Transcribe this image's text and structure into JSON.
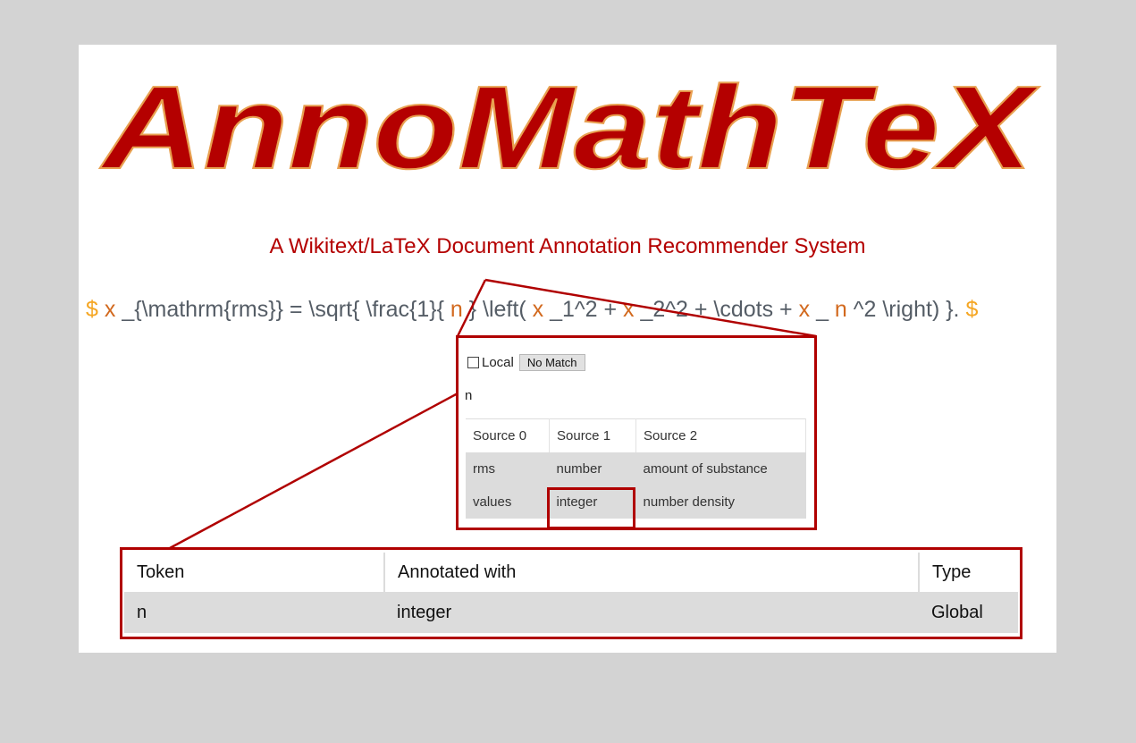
{
  "app": {
    "logo_text": "AnnoMathTeX",
    "subtitle": "A Wikitext/LaTeX Document Annotation Recommender System"
  },
  "formula": {
    "dollar_open": "$",
    "x1": "x",
    "t1": "_{\\mathrm{rms}} = \\sqrt{ \\frac{1}{",
    "n1": "n",
    "t2": "} \\left(",
    "x2": "x",
    "t3": "_1^2 +",
    "x3": "x",
    "t4": "_2^2 + \\cdots +",
    "x4": "x",
    "t5": "_",
    "n2": "n",
    "t6": "^2 \\right) }.",
    "dollar_close": "$"
  },
  "popup": {
    "local_label": "Local",
    "no_match_label": "No Match",
    "token": "n",
    "sources": {
      "headers": [
        "Source 0",
        "Source 1",
        "Source 2"
      ],
      "rows": [
        [
          "rms",
          "number",
          "amount of substance"
        ],
        [
          "values",
          "integer",
          "number density"
        ]
      ]
    }
  },
  "annotations": {
    "headers": [
      "Token",
      "Annotated with",
      "Type"
    ],
    "rows": [
      [
        "n",
        "integer",
        "Global"
      ]
    ]
  },
  "colors": {
    "brand_red": "#b40000",
    "highlight_border": "#b00000",
    "formula_dollar": "#f5a623",
    "formula_identifier": "#d2691e",
    "row_gray": "#dcdcdc",
    "backdrop": "#d3d3d3"
  }
}
